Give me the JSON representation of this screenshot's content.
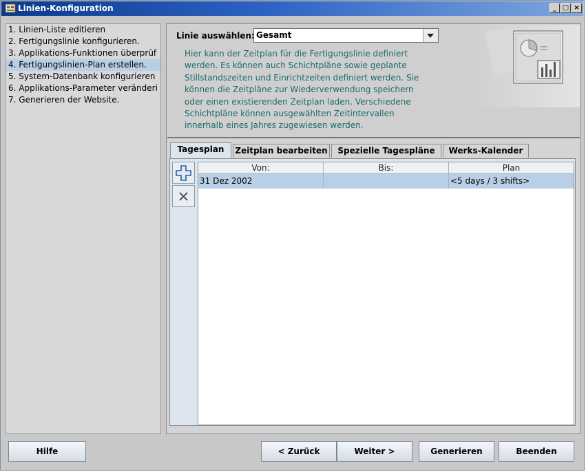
{
  "window": {
    "title": "Linien-Konfiguration",
    "controls": [
      "_",
      "□",
      "×"
    ]
  },
  "steps": [
    {
      "label": "1. Linien-Liste editieren",
      "selected": false
    },
    {
      "label": "2. Fertigungslinie konfigurieren.",
      "selected": false
    },
    {
      "label": "3. Applikations-Funktionen überprüf",
      "selected": false
    },
    {
      "label": "4. Fertigungslinien-Plan erstellen.",
      "selected": true
    },
    {
      "label": "5. System-Datenbank konfigurieren",
      "selected": false
    },
    {
      "label": "6. Applikations-Parameter veränderi",
      "selected": false
    },
    {
      "label": "7. Generieren der Website.",
      "selected": false
    }
  ],
  "header": {
    "line_label": "Linie auswählen:",
    "line_value": "Gesamt",
    "description": [
      "Hier kann der Zeitplan für die Fertigungslinie definiert",
      "werden. Es können auch Schichtpläne sowie geplante",
      "Stillstandszeiten und Einrichtzeiten definiert werden. Sie",
      "können die Zeitpläne zur Wiederverwendung speichern",
      "oder einen existierenden Zeitplan laden. Verschiedene",
      "Schichtpläne können ausgewählten Zeitintervallen",
      "innerhalb eines Jahres zugewiesen werden."
    ]
  },
  "tabs": [
    {
      "label": "Tagesplan",
      "active": true
    },
    {
      "label": "Zeitplan bearbeiten",
      "active": false
    },
    {
      "label": "Spezielle Tagespläne",
      "active": false
    },
    {
      "label": "Werks-Kalender",
      "active": false
    }
  ],
  "toolbar": {
    "add_icon": "plus-icon",
    "delete_icon": "close-icon"
  },
  "table": {
    "columns": [
      "Von:",
      "Bis:",
      "Plan"
    ],
    "rows": [
      {
        "von": "31 Dez 2002",
        "bis": "",
        "plan": "<5 days / 3 shifts>",
        "selected": true
      }
    ]
  },
  "footer": {
    "help": "Hilfe",
    "back": "< Zurück",
    "next": "Weiter >",
    "generate": "Generieren",
    "finish": "Beenden"
  },
  "colors": {
    "title_bar": "#2b62c4",
    "selection": "#b8cfe5",
    "description_text": "#1b6b6b"
  }
}
